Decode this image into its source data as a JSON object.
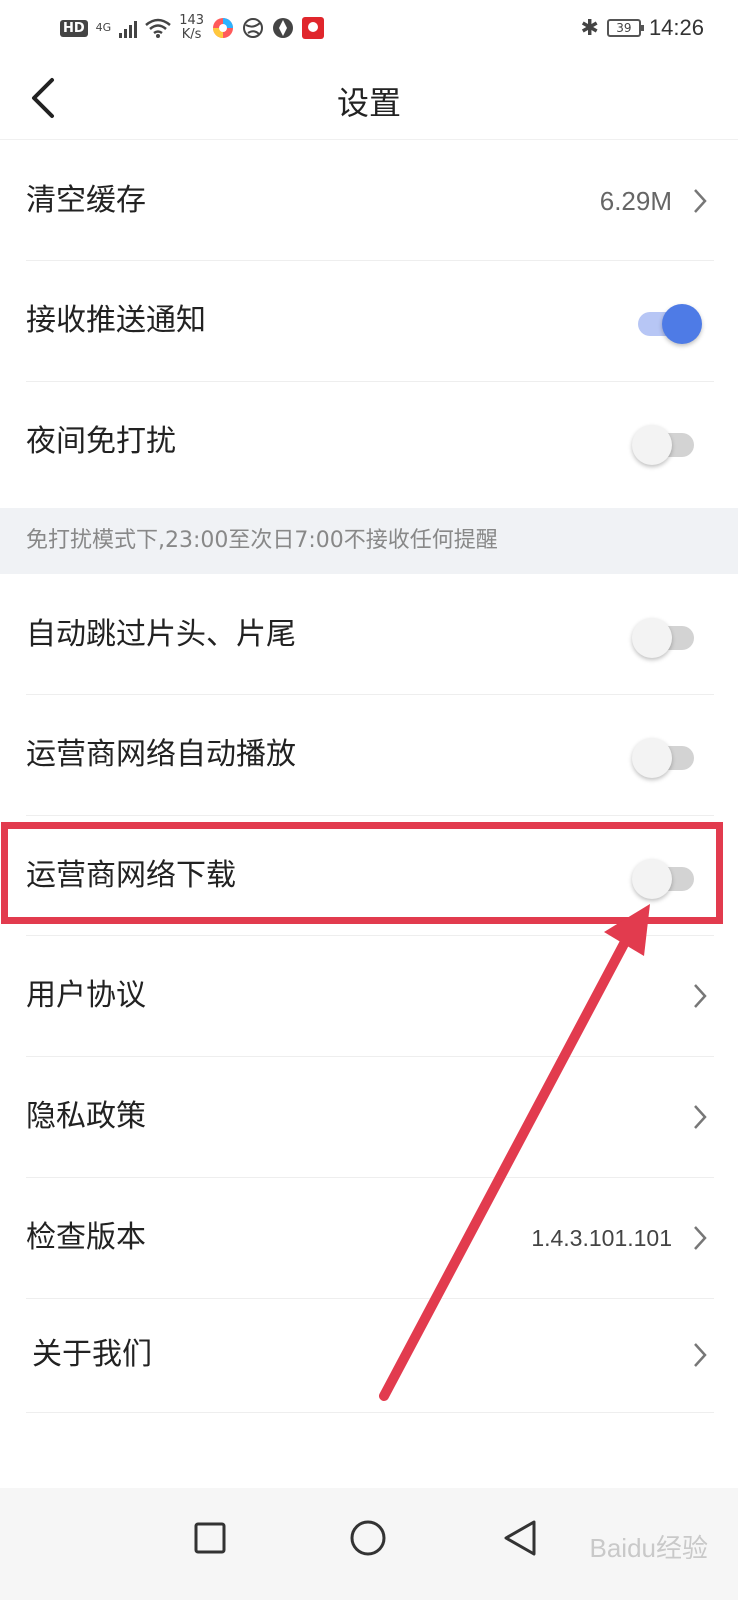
{
  "status_bar": {
    "hd": "HD",
    "network_type": "4G",
    "speed_value": "143",
    "speed_unit": "K/s",
    "battery": "39",
    "time": "14:26"
  },
  "header": {
    "title": "设置"
  },
  "settings": {
    "clear_cache": {
      "label": "清空缓存",
      "value": "6.29M"
    },
    "push_notification": {
      "label": "接收推送通知",
      "enabled": true
    },
    "night_dnd": {
      "label": "夜间免打扰",
      "enabled": false
    },
    "dnd_note": "免打扰模式下,23:00至次日7:00不接收任何提醒",
    "auto_skip": {
      "label": "自动跳过片头、片尾",
      "enabled": false
    },
    "carrier_autoplay": {
      "label": "运营商网络自动播放",
      "enabled": false
    },
    "carrier_download": {
      "label": "运营商网络下载",
      "enabled": false
    },
    "user_agreement": {
      "label": "用户协议"
    },
    "privacy_policy": {
      "label": "隐私政策"
    },
    "check_version": {
      "label": "检查版本",
      "value": "1.4.3.101.101"
    },
    "about_us": {
      "label": "关于我们"
    }
  },
  "watermark": "Baidu经验",
  "colors": {
    "accent": "#4e7be6",
    "annotation": "#e23b4e"
  }
}
